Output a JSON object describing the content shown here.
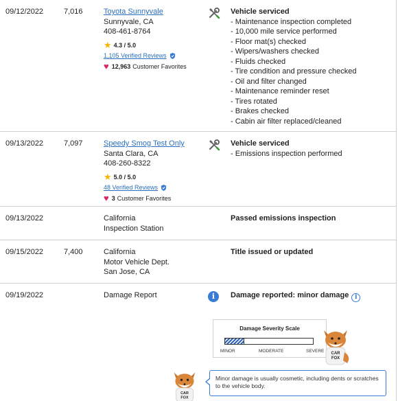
{
  "records": [
    {
      "date": "09/12/2022",
      "odometer": "7,016",
      "source_name": "Toyota Sunnyvale",
      "source_city": "Sunnyvale, CA",
      "source_phone": "408-461-8764",
      "rating": "4.3 / 5.0",
      "reviews": "1,105 Verified Reviews",
      "favorites_count": "12,963",
      "favorites_label": "Customer Favorites",
      "icon": "wrench-screwdriver-icon",
      "title": "Vehicle serviced",
      "items": [
        "Maintenance inspection completed",
        "10,000 mile service performed",
        "Floor mat(s) checked",
        "Wipers/washers checked",
        "Fluids checked",
        "Tire condition and pressure checked",
        "Oil and filter changed",
        "Maintenance reminder reset",
        "Tires rotated",
        "Brakes checked",
        "Cabin air filter replaced/cleaned"
      ]
    },
    {
      "date": "09/13/2022",
      "odometer": "7,097",
      "source_name": "Speedy Smog Test Only",
      "source_city": "Santa Clara, CA",
      "source_phone": "408-260-8322",
      "rating": "5.0 / 5.0",
      "reviews": "48 Verified Reviews",
      "favorites_count": "3",
      "favorites_label": "Customer Favorites",
      "icon": "wrench-screwdriver-icon",
      "title": "Vehicle serviced",
      "items": [
        "Emissions inspection performed"
      ]
    },
    {
      "date": "09/13/2022",
      "source_line1": "California",
      "source_line2": "Inspection Station",
      "title": "Passed emissions inspection"
    },
    {
      "date": "09/15/2022",
      "odometer": "7,400",
      "source_line1": "California",
      "source_line2": "Motor Vehicle Dept.",
      "source_line3": "San Jose, CA",
      "title": "Title issued or updated"
    },
    {
      "date": "09/19/2022",
      "source_line1": "Damage Report",
      "icon": "info-icon",
      "title": "Damage reported: minor damage"
    }
  ],
  "damage_scale": {
    "title": "Damage Severity Scale",
    "labels": [
      "MINOR",
      "MODERATE",
      "SEVERE"
    ],
    "level": 0.22
  },
  "tooltip": "Minor damage is usually cosmetic, including dents or scratches to the vehicle body.",
  "mascot_text": [
    "CAR",
    "FOX"
  ],
  "info_glyph": "i",
  "colors": {
    "link": "#2a6fbf",
    "star": "#f4b400",
    "heart": "#d7265b",
    "info": "#3a7bd5",
    "scale_fill": "#2f63b8"
  }
}
